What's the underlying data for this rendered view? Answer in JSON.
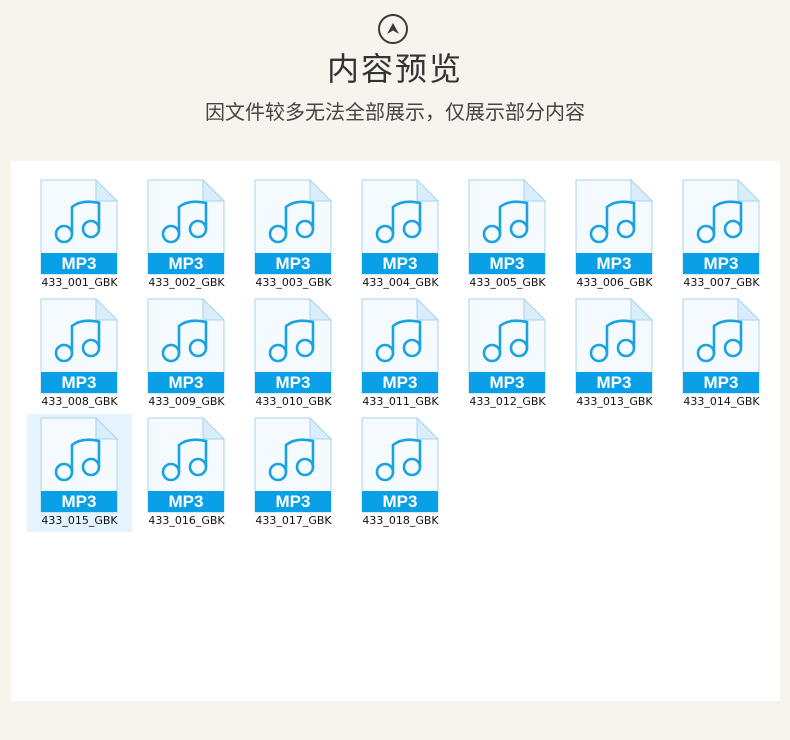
{
  "header": {
    "icon": "chevron-up-circle-icon",
    "title": "内容预览",
    "subtitle": "因文件较多无法全部展示，仅展示部分内容"
  },
  "icon": {
    "name": "mp3-file-icon",
    "label": "MP3",
    "colors": {
      "band": "#0aa0e8",
      "note": "#1aa3e0",
      "page": "#f4fafe",
      "border": "#a8d4ee",
      "fold": "#d9eefa"
    }
  },
  "selected_index": 14,
  "files": [
    {
      "name": "433_001_GBK"
    },
    {
      "name": "433_002_GBK"
    },
    {
      "name": "433_003_GBK"
    },
    {
      "name": "433_004_GBK"
    },
    {
      "name": "433_005_GBK"
    },
    {
      "name": "433_006_GBK"
    },
    {
      "name": "433_007_GBK"
    },
    {
      "name": "433_008_GBK"
    },
    {
      "name": "433_009_GBK"
    },
    {
      "name": "433_010_GBK"
    },
    {
      "name": "433_011_GBK"
    },
    {
      "name": "433_012_GBK"
    },
    {
      "name": "433_013_GBK"
    },
    {
      "name": "433_014_GBK"
    },
    {
      "name": "433_015_GBK"
    },
    {
      "name": "433_016_GBK"
    },
    {
      "name": "433_017_GBK"
    },
    {
      "name": "433_018_GBK"
    }
  ]
}
